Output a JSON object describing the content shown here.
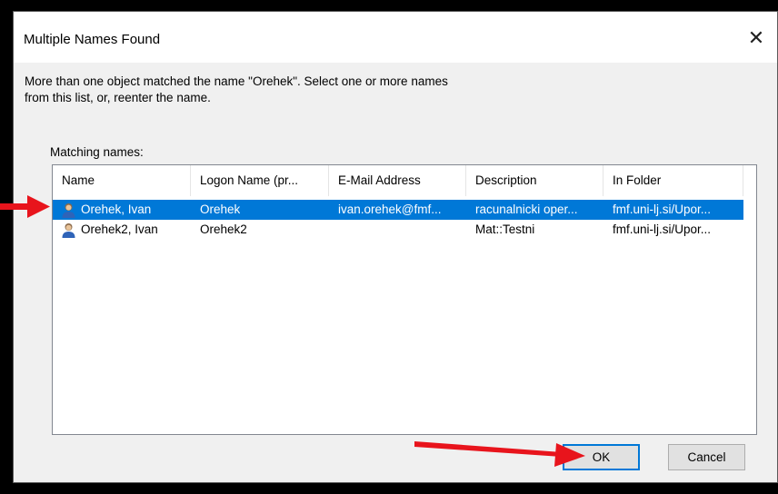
{
  "dialog": {
    "title": "Multiple Names Found",
    "close_glyph": "✕",
    "message_line1": "More than one object matched the name \"Orehek\". Select one or more names",
    "message_line2": "from this list, or, reenter the name.",
    "matching_label": "Matching names:"
  },
  "table": {
    "columns": [
      "Name",
      "Logon Name (pr...",
      "E-Mail Address",
      "Description",
      "In Folder"
    ],
    "rows": [
      {
        "name": "Orehek, Ivan",
        "logon": "Orehek",
        "email": "ivan.orehek@fmf...",
        "description": "racunalnicki oper...",
        "folder": "fmf.uni-lj.si/Upor...",
        "selected": true
      },
      {
        "name": "Orehek2, Ivan",
        "logon": "Orehek2",
        "email": "",
        "description": "Mat::Testni",
        "folder": "fmf.uni-lj.si/Upor...",
        "selected": false
      }
    ],
    "row_icon": "user-icon"
  },
  "buttons": {
    "ok_label": "OK",
    "cancel_label": "Cancel"
  },
  "annotations": {
    "arrow_color": "#e8141c",
    "arrow_icon": "red-arrow-icon"
  },
  "colors": {
    "selection": "#0078d7",
    "dialog_bg": "#f0f0f0"
  }
}
